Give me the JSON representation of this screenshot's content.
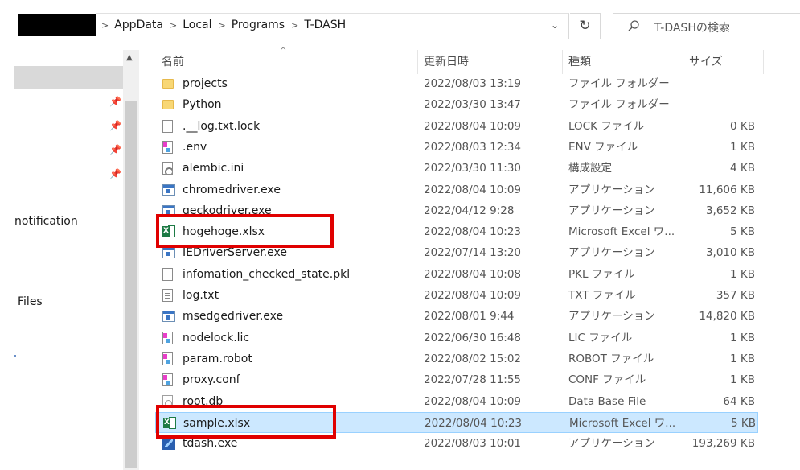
{
  "address": {
    "crumbs": [
      "AppData",
      "Local",
      "Programs",
      "T-DASH"
    ],
    "separator": ">",
    "dropdown_glyph": "⌄",
    "refresh_glyph": "↻"
  },
  "search": {
    "placeholder": "T-DASHの検索"
  },
  "nav": {
    "labels": [
      "notification",
      "Files"
    ],
    "scroll_up_glyph": "▲",
    "pin_glyph": "📌"
  },
  "columns": {
    "name": "名前",
    "date": "更新日時",
    "type": "種類",
    "size": "サイズ",
    "sort_glyph": "^"
  },
  "files": [
    {
      "icon": "folder-icon",
      "name": "projects",
      "date": "2022/08/03 13:19",
      "type": "ファイル フォルダー",
      "size": ""
    },
    {
      "icon": "folder-icon",
      "name": "Python",
      "date": "2022/03/30 13:47",
      "type": "ファイル フォルダー",
      "size": ""
    },
    {
      "icon": "blank-file-icon",
      "name": ".__log.txt.lock",
      "date": "2022/08/04 10:09",
      "type": "LOCK ファイル",
      "size": "0 KB"
    },
    {
      "icon": "colorful-file-icon",
      "name": ".env",
      "date": "2022/08/03 12:34",
      "type": "ENV ファイル",
      "size": "1 KB"
    },
    {
      "icon": "settings-file-icon",
      "name": "alembic.ini",
      "date": "2022/03/30 11:30",
      "type": "構成設定",
      "size": "4 KB"
    },
    {
      "icon": "application-icon",
      "name": "chromedriver.exe",
      "date": "2022/08/04 10:09",
      "type": "アプリケーション",
      "size": "11,606 KB"
    },
    {
      "icon": "application-icon",
      "name": "geckodriver.exe",
      "date": "2022/04/12 9:28",
      "type": "アプリケーション",
      "size": "3,652 KB"
    },
    {
      "icon": "excel-icon",
      "name": "hogehoge.xlsx",
      "date": "2022/08/04 10:23",
      "type": "Microsoft Excel ワ...",
      "size": "5 KB"
    },
    {
      "icon": "application-icon",
      "name": "IEDriverServer.exe",
      "date": "2022/07/14 13:20",
      "type": "アプリケーション",
      "size": "3,010 KB"
    },
    {
      "icon": "blank-file-icon",
      "name": "infomation_checked_state.pkl",
      "date": "2022/08/04 10:08",
      "type": "PKL ファイル",
      "size": "1 KB"
    },
    {
      "icon": "text-file-icon",
      "name": "log.txt",
      "date": "2022/08/04 10:09",
      "type": "TXT ファイル",
      "size": "357 KB"
    },
    {
      "icon": "application-icon",
      "name": "msedgedriver.exe",
      "date": "2022/08/01 9:44",
      "type": "アプリケーション",
      "size": "14,820 KB"
    },
    {
      "icon": "colorful-file-icon",
      "name": "nodelock.lic",
      "date": "2022/06/30 16:48",
      "type": "LIC ファイル",
      "size": "1 KB"
    },
    {
      "icon": "colorful-file-icon",
      "name": "param.robot",
      "date": "2022/08/02 15:02",
      "type": "ROBOT ファイル",
      "size": "1 KB"
    },
    {
      "icon": "colorful-file-icon",
      "name": "proxy.conf",
      "date": "2022/07/28 11:55",
      "type": "CONF ファイル",
      "size": "1 KB"
    },
    {
      "icon": "database-file-icon",
      "name": "root.db",
      "date": "2022/08/04 10:09",
      "type": "Data Base File",
      "size": "64 KB"
    },
    {
      "icon": "excel-icon",
      "name": "sample.xlsx",
      "date": "2022/08/04 10:23",
      "type": "Microsoft Excel ワ...",
      "size": "5 KB",
      "selected": true
    },
    {
      "icon": "tdash-app-icon",
      "name": "tdash.exe",
      "date": "2022/08/03 10:01",
      "type": "アプリケーション",
      "size": "193,269 KB"
    }
  ],
  "colors": {
    "selection_bg": "#cce8ff",
    "selection_border": "#99d1ff",
    "highlight_red": "#e00000"
  }
}
